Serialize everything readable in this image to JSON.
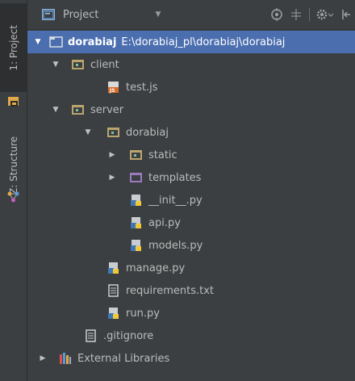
{
  "sidebar": {
    "tabs": [
      {
        "label": "1: Project"
      },
      {
        "label": "Z: Structure"
      }
    ]
  },
  "header": {
    "title": "Project",
    "icons": [
      "target-icon",
      "collapse-icon",
      "gear-icon",
      "hide-icon"
    ]
  },
  "tree": {
    "items": [
      {
        "label": "dorabiaj",
        "path": "E:\\dorabiaj_pl\\dorabiaj\\dorabiaj",
        "type": "folder",
        "expanded": true,
        "selected": true
      },
      {
        "label": "client",
        "type": "folder",
        "expanded": true
      },
      {
        "label": "test.js",
        "type": "js-file"
      },
      {
        "label": "server",
        "type": "folder",
        "expanded": true
      },
      {
        "label": "dorabiaj",
        "type": "folder",
        "expanded": true
      },
      {
        "label": "static",
        "type": "folder",
        "expanded": false
      },
      {
        "label": "templates",
        "type": "template-folder",
        "expanded": false
      },
      {
        "label": "__init__.py",
        "type": "python-file"
      },
      {
        "label": "api.py",
        "type": "python-file"
      },
      {
        "label": "models.py",
        "type": "python-file"
      },
      {
        "label": "manage.py",
        "type": "python-file"
      },
      {
        "label": "requirements.txt",
        "type": "text-file"
      },
      {
        "label": "run.py",
        "type": "python-file"
      },
      {
        "label": ".gitignore",
        "type": "text-file"
      },
      {
        "label": "External Libraries",
        "type": "library",
        "expanded": false
      }
    ]
  },
  "colors": {
    "background": "#3c3f41",
    "selection": "#4b6eaf",
    "text": "#bbbbbb"
  }
}
